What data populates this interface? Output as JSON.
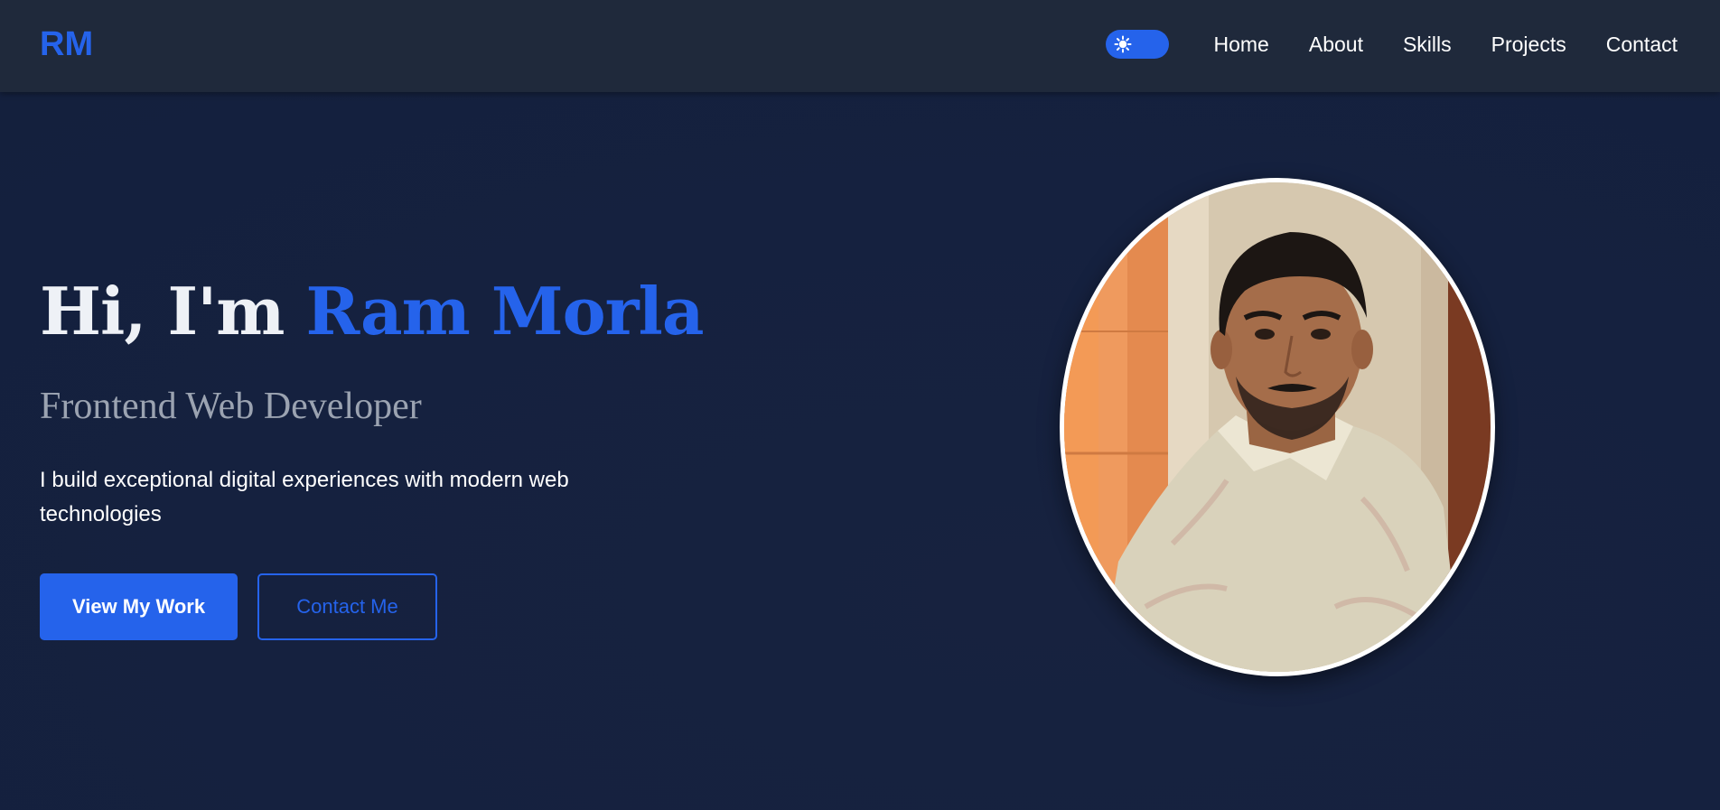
{
  "header": {
    "logo": "RM",
    "theme_toggle_icon": "sun-icon",
    "nav": [
      {
        "label": "Home"
      },
      {
        "label": "About"
      },
      {
        "label": "Skills"
      },
      {
        "label": "Projects"
      },
      {
        "label": "Contact"
      }
    ]
  },
  "hero": {
    "greeting": "Hi, I'm ",
    "name": "Ram Morla",
    "subtitle": "Frontend Web Developer",
    "tagline": "I build exceptional digital experiences with modern web technologies",
    "primary_button": "View My Work",
    "secondary_button": "Contact Me",
    "profile_image_icon": "profile-photo"
  },
  "colors": {
    "accent": "#2563eb",
    "nav_background": "#1f293b",
    "page_background": "#15213f",
    "heading_text": "#eef1f6",
    "subtitle_text": "#9ba3b1"
  }
}
